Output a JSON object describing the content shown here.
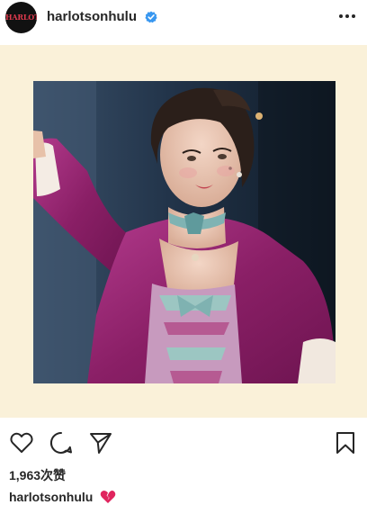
{
  "post": {
    "account": {
      "avatar_text": "HARLOTS",
      "username": "harlotsonhulu",
      "verified": true
    },
    "more_icon": "more-horizontal-icon",
    "photo": {
      "description_icon": "portrait-photo",
      "background_color": "#faf1d9"
    },
    "actions": {
      "like_icon": "heart-outline-icon",
      "comment_icon": "comment-bubble-icon",
      "share_icon": "paper-plane-icon",
      "save_icon": "bookmark-icon"
    },
    "likes_text": "1,963次赞",
    "caption": {
      "username": "harlotsonhulu",
      "emoji": "broken-heart-icon"
    }
  }
}
